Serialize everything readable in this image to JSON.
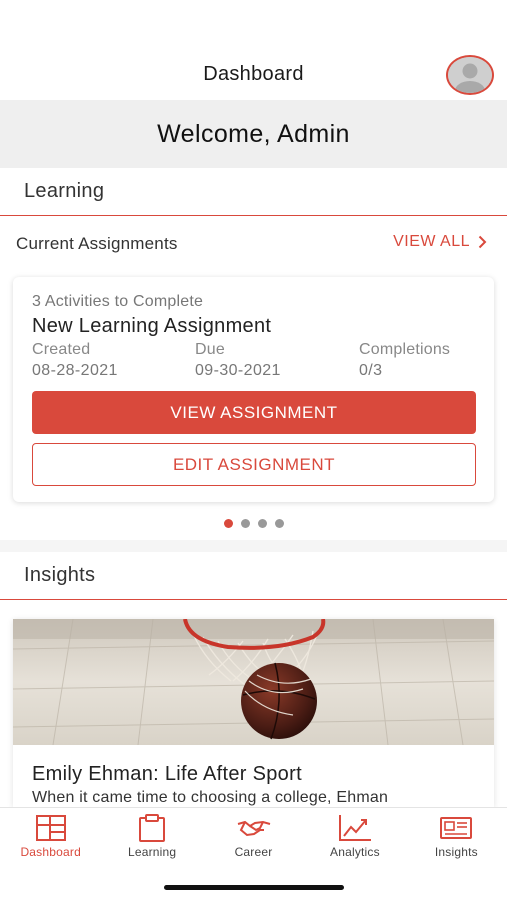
{
  "header": {
    "title": "Dashboard",
    "avatar_icon": "user-avatar-icon"
  },
  "welcome": {
    "text": "Welcome, Admin"
  },
  "learning": {
    "section_title": "Learning",
    "current_assignments_label": "Current Assignments",
    "view_all_label": "VIEW ALL",
    "assignment": {
      "subtitle": "3 Activities to Complete",
      "title": "New Learning Assignment",
      "created_label": "Created",
      "created_value": "08-28-2021",
      "due_label": "Due",
      "due_value": "09-30-2021",
      "completions_label": "Completions",
      "completions_value": "0/3",
      "view_button": "VIEW ASSIGNMENT",
      "edit_button": "EDIT ASSIGNMENT"
    },
    "carousel": {
      "count": 4,
      "active_index": 0
    }
  },
  "insights": {
    "section_title": "Insights",
    "article": {
      "image_icon": "basketball-hoop-image",
      "title": "Emily Ehman: Life After Sport",
      "snippet": "When it came time to choosing a college, Ehman"
    }
  },
  "tabs": [
    {
      "label": "Dashboard",
      "icon": "dashboard-icon",
      "active": true
    },
    {
      "label": "Learning",
      "icon": "clipboard-icon",
      "active": false
    },
    {
      "label": "Career",
      "icon": "handshake-icon",
      "active": false
    },
    {
      "label": "Analytics",
      "icon": "analytics-chart-icon",
      "active": false
    },
    {
      "label": "Insights",
      "icon": "newspaper-icon",
      "active": false
    }
  ],
  "colors": {
    "accent": "#d9493c",
    "welcome_bg": "#efefef",
    "text": "#222222"
  }
}
